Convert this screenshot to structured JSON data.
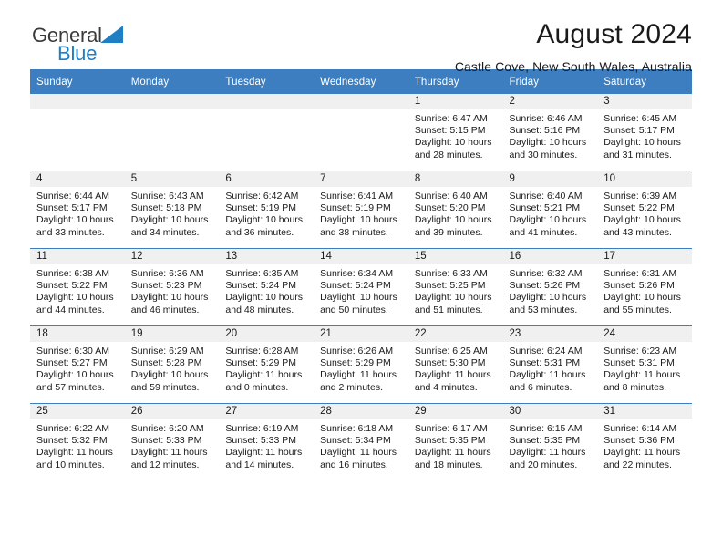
{
  "brand": {
    "line1": "General",
    "line2": "Blue",
    "triangle_color": "#1f7fc4",
    "line1_color": "#3a3a3a",
    "line2_color": "#1f7fc4"
  },
  "header": {
    "title": "August 2024",
    "subtitle": "Castle Cove, New South Wales, Australia"
  },
  "colors": {
    "header_blue": "#3c7ebf",
    "daynum_band": "#f0f0f0",
    "text": "#1a1a1a"
  },
  "weekdays": [
    "Sunday",
    "Monday",
    "Tuesday",
    "Wednesday",
    "Thursday",
    "Friday",
    "Saturday"
  ],
  "labels": {
    "sunrise": "Sunrise:",
    "sunset": "Sunset:",
    "daylight": "Daylight:"
  },
  "weeks": [
    [
      {
        "day": "",
        "sunrise": "",
        "sunset": "",
        "daylight_line1": "",
        "daylight_line2": ""
      },
      {
        "day": "",
        "sunrise": "",
        "sunset": "",
        "daylight_line1": "",
        "daylight_line2": ""
      },
      {
        "day": "",
        "sunrise": "",
        "sunset": "",
        "daylight_line1": "",
        "daylight_line2": ""
      },
      {
        "day": "",
        "sunrise": "",
        "sunset": "",
        "daylight_line1": "",
        "daylight_line2": ""
      },
      {
        "day": "1",
        "sunrise": "Sunrise: 6:47 AM",
        "sunset": "Sunset: 5:15 PM",
        "daylight_line1": "Daylight: 10 hours",
        "daylight_line2": "and 28 minutes."
      },
      {
        "day": "2",
        "sunrise": "Sunrise: 6:46 AM",
        "sunset": "Sunset: 5:16 PM",
        "daylight_line1": "Daylight: 10 hours",
        "daylight_line2": "and 30 minutes."
      },
      {
        "day": "3",
        "sunrise": "Sunrise: 6:45 AM",
        "sunset": "Sunset: 5:17 PM",
        "daylight_line1": "Daylight: 10 hours",
        "daylight_line2": "and 31 minutes."
      }
    ],
    [
      {
        "day": "4",
        "sunrise": "Sunrise: 6:44 AM",
        "sunset": "Sunset: 5:17 PM",
        "daylight_line1": "Daylight: 10 hours",
        "daylight_line2": "and 33 minutes."
      },
      {
        "day": "5",
        "sunrise": "Sunrise: 6:43 AM",
        "sunset": "Sunset: 5:18 PM",
        "daylight_line1": "Daylight: 10 hours",
        "daylight_line2": "and 34 minutes."
      },
      {
        "day": "6",
        "sunrise": "Sunrise: 6:42 AM",
        "sunset": "Sunset: 5:19 PM",
        "daylight_line1": "Daylight: 10 hours",
        "daylight_line2": "and 36 minutes."
      },
      {
        "day": "7",
        "sunrise": "Sunrise: 6:41 AM",
        "sunset": "Sunset: 5:19 PM",
        "daylight_line1": "Daylight: 10 hours",
        "daylight_line2": "and 38 minutes."
      },
      {
        "day": "8",
        "sunrise": "Sunrise: 6:40 AM",
        "sunset": "Sunset: 5:20 PM",
        "daylight_line1": "Daylight: 10 hours",
        "daylight_line2": "and 39 minutes."
      },
      {
        "day": "9",
        "sunrise": "Sunrise: 6:40 AM",
        "sunset": "Sunset: 5:21 PM",
        "daylight_line1": "Daylight: 10 hours",
        "daylight_line2": "and 41 minutes."
      },
      {
        "day": "10",
        "sunrise": "Sunrise: 6:39 AM",
        "sunset": "Sunset: 5:22 PM",
        "daylight_line1": "Daylight: 10 hours",
        "daylight_line2": "and 43 minutes."
      }
    ],
    [
      {
        "day": "11",
        "sunrise": "Sunrise: 6:38 AM",
        "sunset": "Sunset: 5:22 PM",
        "daylight_line1": "Daylight: 10 hours",
        "daylight_line2": "and 44 minutes."
      },
      {
        "day": "12",
        "sunrise": "Sunrise: 6:36 AM",
        "sunset": "Sunset: 5:23 PM",
        "daylight_line1": "Daylight: 10 hours",
        "daylight_line2": "and 46 minutes."
      },
      {
        "day": "13",
        "sunrise": "Sunrise: 6:35 AM",
        "sunset": "Sunset: 5:24 PM",
        "daylight_line1": "Daylight: 10 hours",
        "daylight_line2": "and 48 minutes."
      },
      {
        "day": "14",
        "sunrise": "Sunrise: 6:34 AM",
        "sunset": "Sunset: 5:24 PM",
        "daylight_line1": "Daylight: 10 hours",
        "daylight_line2": "and 50 minutes."
      },
      {
        "day": "15",
        "sunrise": "Sunrise: 6:33 AM",
        "sunset": "Sunset: 5:25 PM",
        "daylight_line1": "Daylight: 10 hours",
        "daylight_line2": "and 51 minutes."
      },
      {
        "day": "16",
        "sunrise": "Sunrise: 6:32 AM",
        "sunset": "Sunset: 5:26 PM",
        "daylight_line1": "Daylight: 10 hours",
        "daylight_line2": "and 53 minutes."
      },
      {
        "day": "17",
        "sunrise": "Sunrise: 6:31 AM",
        "sunset": "Sunset: 5:26 PM",
        "daylight_line1": "Daylight: 10 hours",
        "daylight_line2": "and 55 minutes."
      }
    ],
    [
      {
        "day": "18",
        "sunrise": "Sunrise: 6:30 AM",
        "sunset": "Sunset: 5:27 PM",
        "daylight_line1": "Daylight: 10 hours",
        "daylight_line2": "and 57 minutes."
      },
      {
        "day": "19",
        "sunrise": "Sunrise: 6:29 AM",
        "sunset": "Sunset: 5:28 PM",
        "daylight_line1": "Daylight: 10 hours",
        "daylight_line2": "and 59 minutes."
      },
      {
        "day": "20",
        "sunrise": "Sunrise: 6:28 AM",
        "sunset": "Sunset: 5:29 PM",
        "daylight_line1": "Daylight: 11 hours",
        "daylight_line2": "and 0 minutes."
      },
      {
        "day": "21",
        "sunrise": "Sunrise: 6:26 AM",
        "sunset": "Sunset: 5:29 PM",
        "daylight_line1": "Daylight: 11 hours",
        "daylight_line2": "and 2 minutes."
      },
      {
        "day": "22",
        "sunrise": "Sunrise: 6:25 AM",
        "sunset": "Sunset: 5:30 PM",
        "daylight_line1": "Daylight: 11 hours",
        "daylight_line2": "and 4 minutes."
      },
      {
        "day": "23",
        "sunrise": "Sunrise: 6:24 AM",
        "sunset": "Sunset: 5:31 PM",
        "daylight_line1": "Daylight: 11 hours",
        "daylight_line2": "and 6 minutes."
      },
      {
        "day": "24",
        "sunrise": "Sunrise: 6:23 AM",
        "sunset": "Sunset: 5:31 PM",
        "daylight_line1": "Daylight: 11 hours",
        "daylight_line2": "and 8 minutes."
      }
    ],
    [
      {
        "day": "25",
        "sunrise": "Sunrise: 6:22 AM",
        "sunset": "Sunset: 5:32 PM",
        "daylight_line1": "Daylight: 11 hours",
        "daylight_line2": "and 10 minutes."
      },
      {
        "day": "26",
        "sunrise": "Sunrise: 6:20 AM",
        "sunset": "Sunset: 5:33 PM",
        "daylight_line1": "Daylight: 11 hours",
        "daylight_line2": "and 12 minutes."
      },
      {
        "day": "27",
        "sunrise": "Sunrise: 6:19 AM",
        "sunset": "Sunset: 5:33 PM",
        "daylight_line1": "Daylight: 11 hours",
        "daylight_line2": "and 14 minutes."
      },
      {
        "day": "28",
        "sunrise": "Sunrise: 6:18 AM",
        "sunset": "Sunset: 5:34 PM",
        "daylight_line1": "Daylight: 11 hours",
        "daylight_line2": "and 16 minutes."
      },
      {
        "day": "29",
        "sunrise": "Sunrise: 6:17 AM",
        "sunset": "Sunset: 5:35 PM",
        "daylight_line1": "Daylight: 11 hours",
        "daylight_line2": "and 18 minutes."
      },
      {
        "day": "30",
        "sunrise": "Sunrise: 6:15 AM",
        "sunset": "Sunset: 5:35 PM",
        "daylight_line1": "Daylight: 11 hours",
        "daylight_line2": "and 20 minutes."
      },
      {
        "day": "31",
        "sunrise": "Sunrise: 6:14 AM",
        "sunset": "Sunset: 5:36 PM",
        "daylight_line1": "Daylight: 11 hours",
        "daylight_line2": "and 22 minutes."
      }
    ]
  ]
}
